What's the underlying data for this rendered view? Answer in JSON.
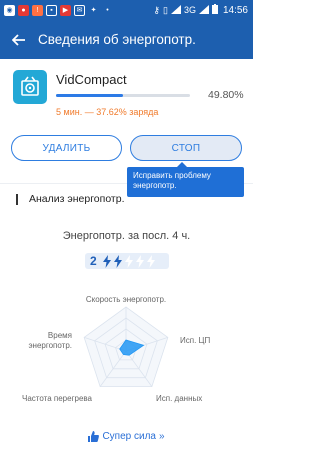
{
  "status_bar": {
    "network": "3G",
    "time": "14:56"
  },
  "appbar": {
    "title": "Сведения об энергопотр."
  },
  "app": {
    "name": "VidCompact",
    "percent_label": "49.80%",
    "progress": 0.498,
    "drain_text": "5 мин. — 37.62% заряда"
  },
  "buttons": {
    "delete_label": "УДАЛИТЬ",
    "stop_label": "СТОП"
  },
  "tooltip": {
    "text": "Исправить проблему энергопотр."
  },
  "analysis": {
    "section_title": "Анализ энергопотр.",
    "period_label": "Энергопотр. за посл. 4 ч.",
    "level_number": "2",
    "level_active": 2,
    "level_total": 5
  },
  "radar": {
    "labels": {
      "top": "Скорость энергопотр.",
      "right": "Исп. ЦП",
      "bottom_right": "Исп. данных",
      "bottom_left": "Частота перегрева",
      "left_line1": "Время",
      "left_line2": "энергопотр."
    },
    "values": [
      0.25,
      0.42,
      0.12,
      0.1,
      0.15
    ],
    "fill_color": "#2196f3"
  },
  "footer": {
    "super_label": "Супер сила",
    "chevron": "»"
  },
  "colors": {
    "primary": "#1d5faf",
    "accent": "#2e7de0",
    "warning": "#f07b2c"
  }
}
